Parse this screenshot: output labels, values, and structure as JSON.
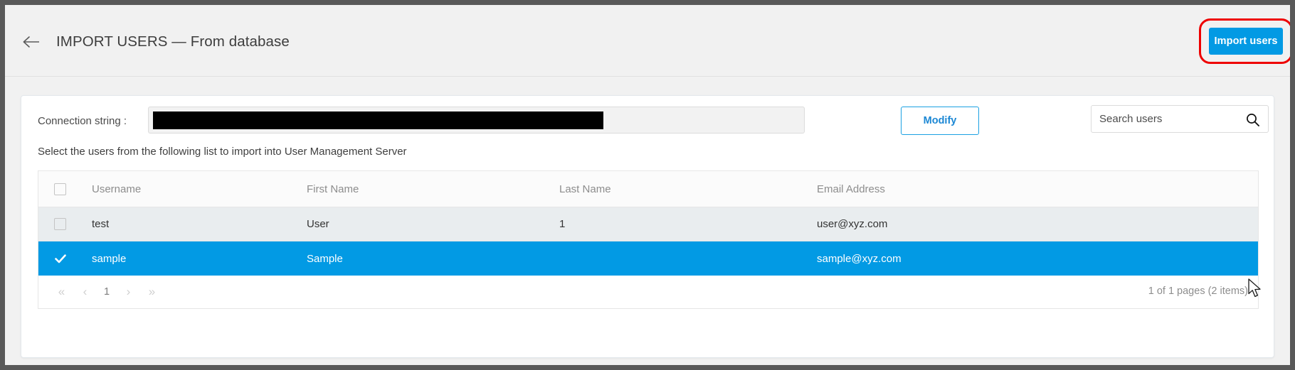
{
  "header": {
    "back_icon": "back-arrow-icon",
    "title": "IMPORT USERS — From database",
    "import_button": "Import users",
    "annotation_color": "#ee0000",
    "accent_color": "#029ae4"
  },
  "connection": {
    "label": "Connection string :",
    "value": "",
    "redacted": true,
    "modify_button": "Modify"
  },
  "search": {
    "placeholder": "Search users",
    "value": "",
    "icon": "search-icon"
  },
  "instruction": "Select the users from the following list to import into User Management Server",
  "table": {
    "columns": [
      "Username",
      "First Name",
      "Last Name",
      "Email Address"
    ],
    "select_all_checked": false,
    "rows": [
      {
        "selected": false,
        "username": "test",
        "first_name": "User",
        "last_name": "1",
        "email": "user@xyz.com"
      },
      {
        "selected": true,
        "username": "sample",
        "first_name": "Sample",
        "last_name": "",
        "email": "sample@xyz.com"
      }
    ]
  },
  "pager": {
    "first": "«",
    "prev": "‹",
    "current_page": "1",
    "next": "›",
    "last": "»",
    "info": "1 of 1 pages (2 items)"
  }
}
